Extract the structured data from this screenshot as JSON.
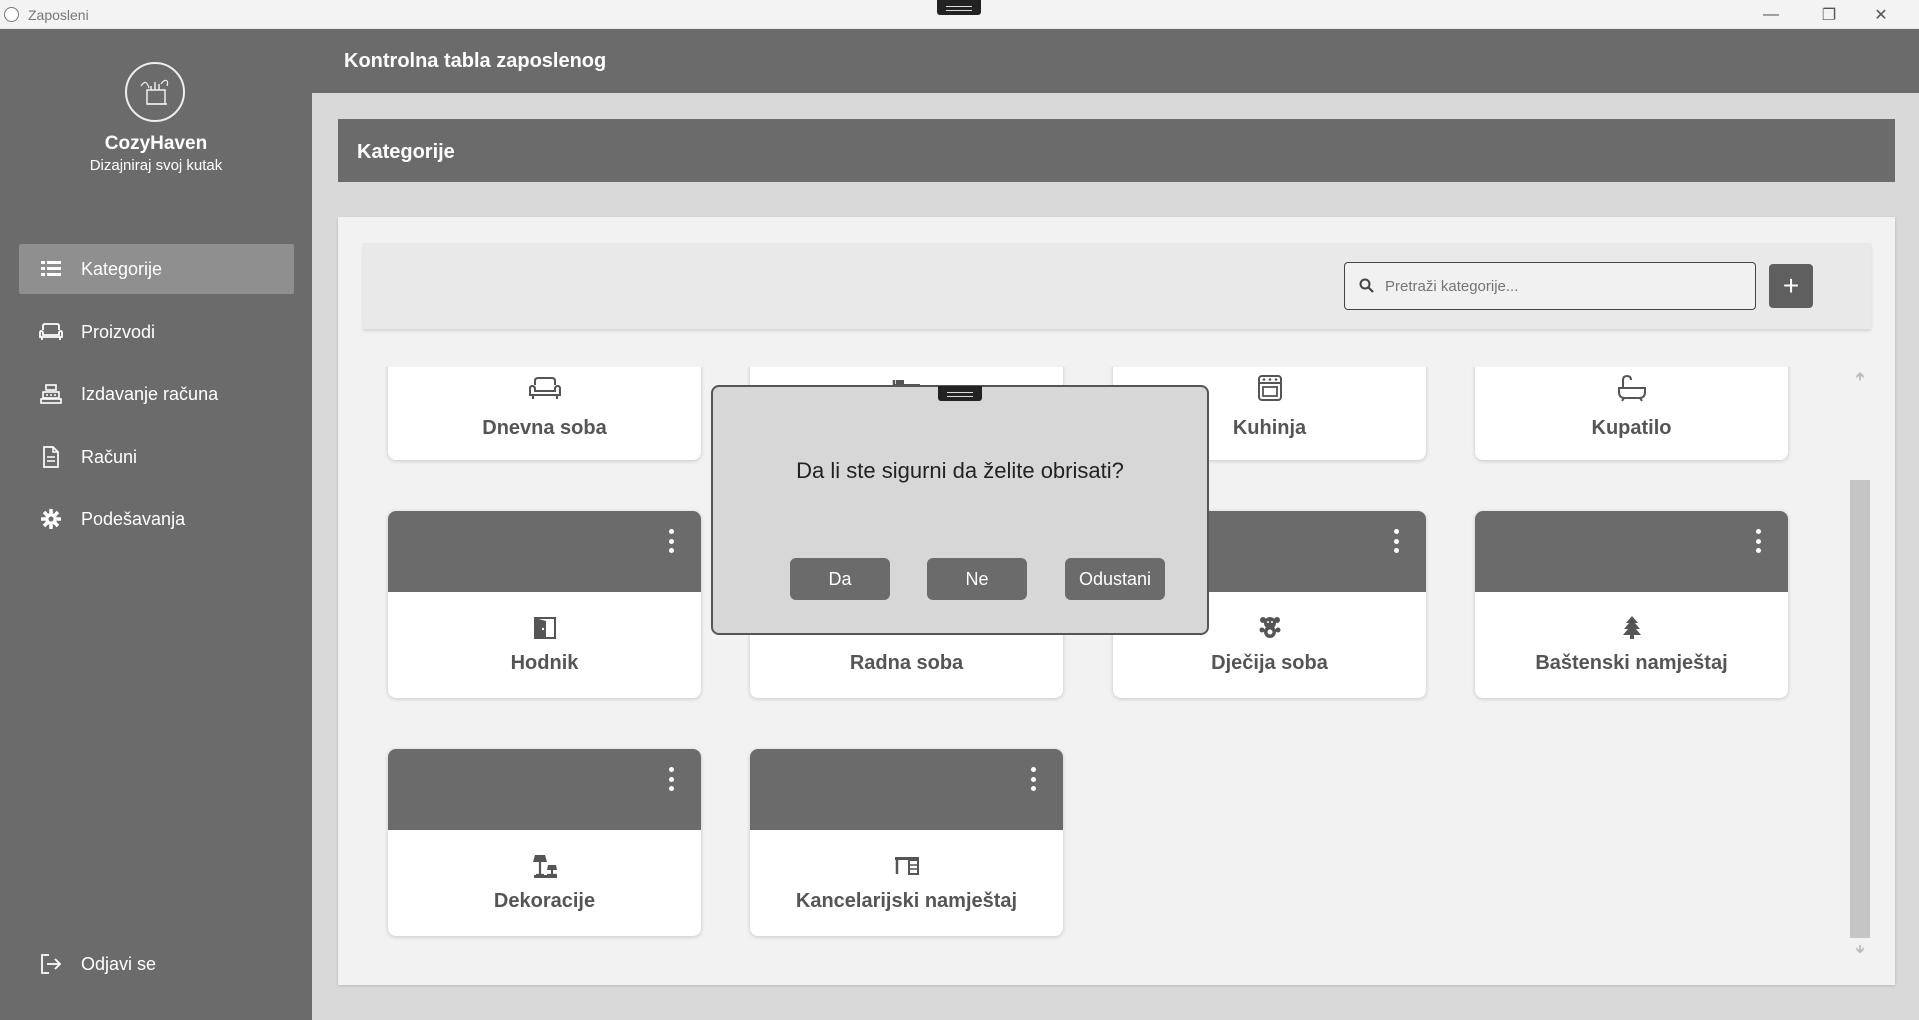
{
  "window": {
    "title": "Zaposleni",
    "controls": [
      "minimize",
      "maximize",
      "close"
    ]
  },
  "sidebar": {
    "brand_name": "CozyHaven",
    "brand_tagline": "Dizajniraj svoj kutak",
    "items": [
      {
        "label": "Kategorije",
        "icon": "list-icon",
        "active": true
      },
      {
        "label": "Proizvodi",
        "icon": "sofa-icon",
        "active": false
      },
      {
        "label": "Izdavanje računa",
        "icon": "cash-register-icon",
        "active": false
      },
      {
        "label": "Računi",
        "icon": "document-icon",
        "active": false
      },
      {
        "label": "Podešavanja",
        "icon": "gear-icon",
        "active": false
      }
    ],
    "logout_label": "Odjavi se"
  },
  "header": {
    "title": "Kontrolna tabla zaposlenog"
  },
  "section": {
    "title": "Kategorije"
  },
  "toolbar": {
    "search_placeholder": "Pretraži kategorije...",
    "add_label": "+"
  },
  "categories": [
    {
      "name": "Dnevna soba",
      "icon": "sofa-icon"
    },
    {
      "name": "",
      "icon": "bed-icon"
    },
    {
      "name": "Kuhinja",
      "icon": "oven-icon"
    },
    {
      "name": "Kupatilo",
      "icon": "bathtub-icon"
    },
    {
      "name": "Hodnik",
      "icon": "door-icon"
    },
    {
      "name": "Radna soba",
      "icon": "desk-icon"
    },
    {
      "name": "Dječija soba",
      "icon": "teddy-bear-icon"
    },
    {
      "name": "Baštenski namještaj",
      "icon": "tree-icon"
    },
    {
      "name": "Dekoracije",
      "icon": "lamp-icon"
    },
    {
      "name": "Kancelarijski namještaj",
      "icon": "office-desk-icon"
    }
  ],
  "dialog": {
    "message": "Da li ste sigurni da želite obrisati?",
    "yes_label": "Da",
    "no_label": "Ne",
    "cancel_label": "Odustani"
  },
  "colors": {
    "primary": "#6b6b6b",
    "sidebar_active": "#8f8f8f",
    "background": "#d9d9d9",
    "card": "#ffffff"
  }
}
